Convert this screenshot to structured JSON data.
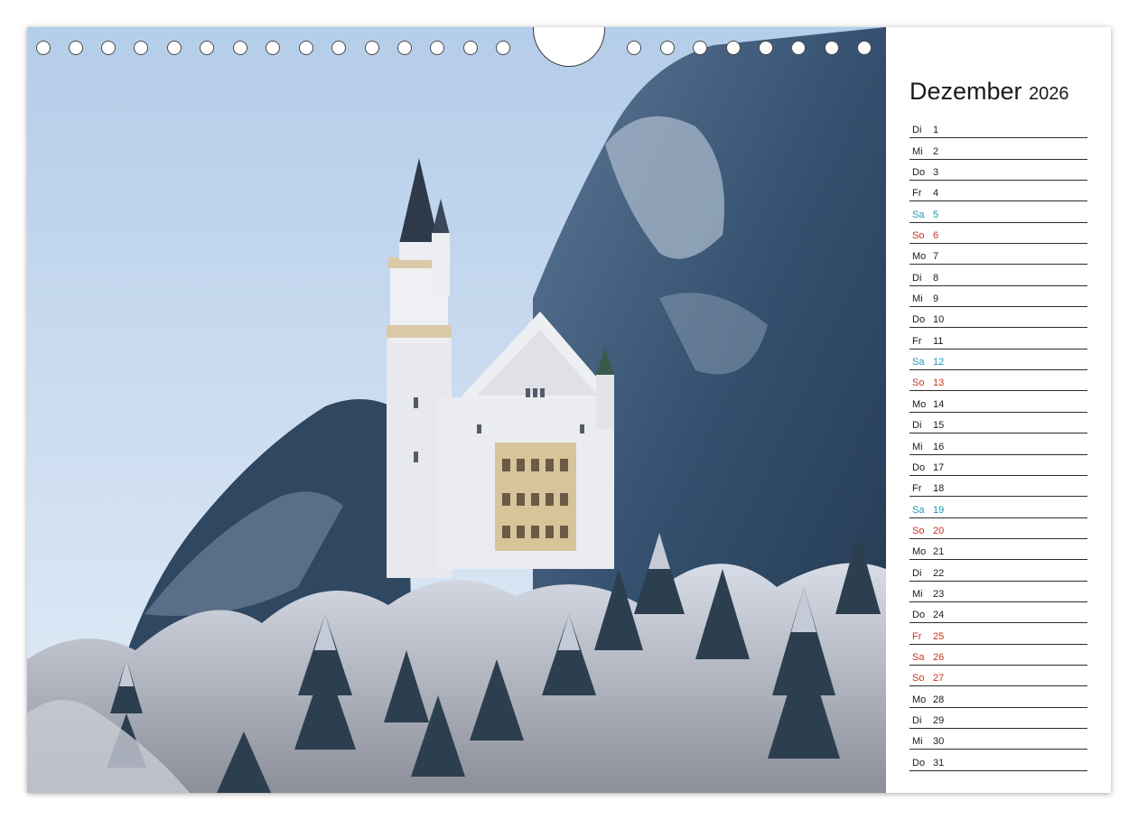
{
  "calendar": {
    "month": "Dezember",
    "year": "2026",
    "days": [
      {
        "wd": "Di",
        "d": "1",
        "type": ""
      },
      {
        "wd": "Mi",
        "d": "2",
        "type": ""
      },
      {
        "wd": "Do",
        "d": "3",
        "type": ""
      },
      {
        "wd": "Fr",
        "d": "4",
        "type": ""
      },
      {
        "wd": "Sa",
        "d": "5",
        "type": "sat"
      },
      {
        "wd": "So",
        "d": "6",
        "type": "sun"
      },
      {
        "wd": "Mo",
        "d": "7",
        "type": ""
      },
      {
        "wd": "Di",
        "d": "8",
        "type": ""
      },
      {
        "wd": "Mi",
        "d": "9",
        "type": ""
      },
      {
        "wd": "Do",
        "d": "10",
        "type": ""
      },
      {
        "wd": "Fr",
        "d": "11",
        "type": ""
      },
      {
        "wd": "Sa",
        "d": "12",
        "type": "sat"
      },
      {
        "wd": "So",
        "d": "13",
        "type": "sun"
      },
      {
        "wd": "Mo",
        "d": "14",
        "type": ""
      },
      {
        "wd": "Di",
        "d": "15",
        "type": ""
      },
      {
        "wd": "Mi",
        "d": "16",
        "type": ""
      },
      {
        "wd": "Do",
        "d": "17",
        "type": ""
      },
      {
        "wd": "Fr",
        "d": "18",
        "type": ""
      },
      {
        "wd": "Sa",
        "d": "19",
        "type": "sat"
      },
      {
        "wd": "So",
        "d": "20",
        "type": "sun"
      },
      {
        "wd": "Mo",
        "d": "21",
        "type": ""
      },
      {
        "wd": "Di",
        "d": "22",
        "type": ""
      },
      {
        "wd": "Mi",
        "d": "23",
        "type": ""
      },
      {
        "wd": "Do",
        "d": "24",
        "type": ""
      },
      {
        "wd": "Fr",
        "d": "25",
        "type": "hol"
      },
      {
        "wd": "Sa",
        "d": "26",
        "type": "hol"
      },
      {
        "wd": "So",
        "d": "27",
        "type": "sun"
      },
      {
        "wd": "Mo",
        "d": "28",
        "type": ""
      },
      {
        "wd": "Di",
        "d": "29",
        "type": ""
      },
      {
        "wd": "Mi",
        "d": "30",
        "type": ""
      },
      {
        "wd": "Do",
        "d": "31",
        "type": ""
      }
    ]
  },
  "colors": {
    "saturday": "#1a9ab0",
    "sunday_holiday": "#cc3322",
    "text": "#1a1a1a"
  }
}
